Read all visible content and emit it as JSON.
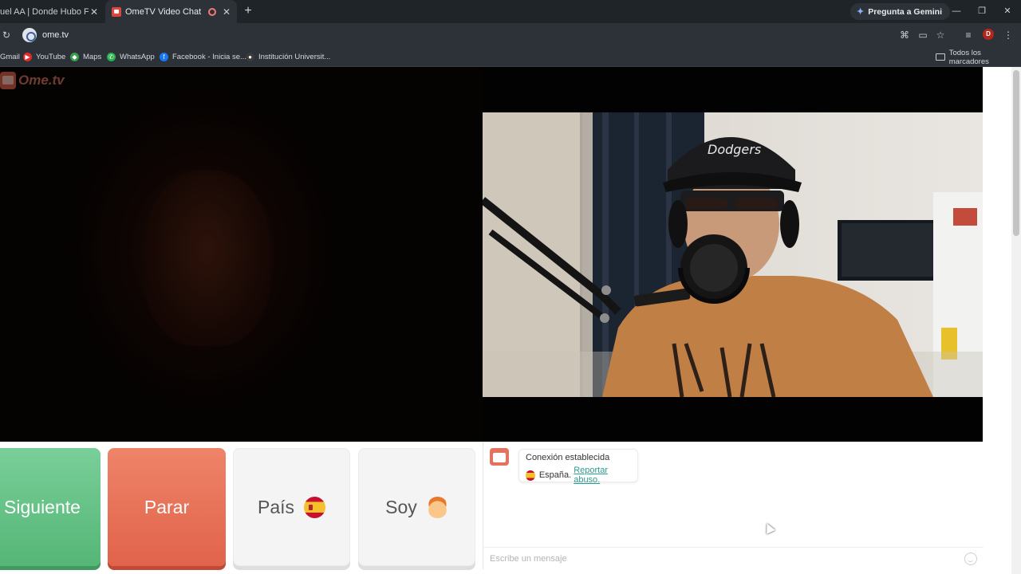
{
  "browser": {
    "tabs": [
      {
        "title": "uel AA | Donde Hubo Fuego",
        "active": false
      },
      {
        "title": "OmeTV Video Chat — Ome",
        "active": true
      }
    ],
    "gemini_label": "Pregunta a Gemini",
    "url": "ome.tv",
    "profile_initial": "D",
    "bookmarks": [
      {
        "label": "Gmail"
      },
      {
        "label": "YouTube"
      },
      {
        "label": "Maps"
      },
      {
        "label": "WhatsApp"
      },
      {
        "label": "Facebook - Inicia se..."
      },
      {
        "label": "Institución Universit..."
      }
    ],
    "all_bookmarks_label": "Todos los marcadores"
  },
  "site": {
    "logo_text": "Ome.tv"
  },
  "controls": {
    "next_label": "Siguiente",
    "stop_label": "Parar",
    "country_label": "País",
    "gender_label": "Soy"
  },
  "chat": {
    "status": "Conexión establecida",
    "country": "España.",
    "report_link": "Reportar abuso.",
    "input_placeholder": "Escribe un mensaje"
  },
  "colors": {
    "next": "#5cbd7e",
    "stop": "#e66a50",
    "link": "#2a9d8f"
  }
}
